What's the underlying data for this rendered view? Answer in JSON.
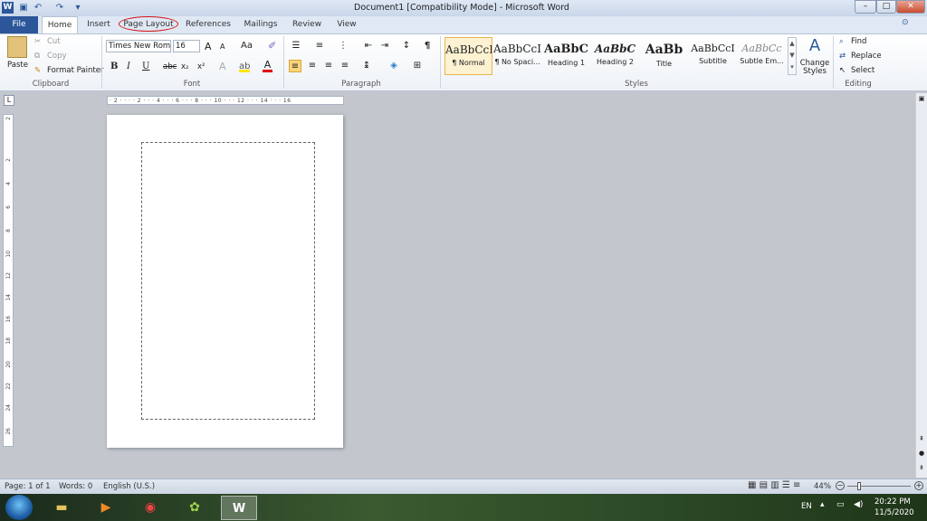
{
  "window": {
    "title": "Document1 [Compatibility Mode]  -  Microsoft Word",
    "logo": "W",
    "qat_icons": [
      "save-icon",
      "undo-icon",
      "redo-icon",
      "customize-qat-icon"
    ],
    "controls": {
      "minimize": "–",
      "maximize": "□",
      "close": "✕"
    }
  },
  "tabs": {
    "file": "File",
    "items": [
      "Home",
      "Insert",
      "Page Layout",
      "References",
      "Mailings",
      "Review",
      "View"
    ],
    "active": "Home",
    "highlighted": "Page Layout"
  },
  "clipboard": {
    "paste": "Paste",
    "cut": "Cut",
    "copy": "Copy",
    "format_painter": "Format Painter",
    "label": "Clipboard"
  },
  "font": {
    "family": "Times New Rom",
    "size": "16",
    "grow": "A",
    "shrink": "A",
    "case": "Aa",
    "clear": "",
    "bold": "B",
    "italic": "I",
    "underline": "U",
    "strike": "abc",
    "subscript": "x₂",
    "superscript": "x²",
    "label": "Font"
  },
  "paragraph": {
    "label": "Paragraph",
    "show_marks": "¶"
  },
  "styles": {
    "label": "Styles",
    "items": [
      {
        "sample": "AaBbCcI",
        "name": "¶ Normal"
      },
      {
        "sample": "AaBbCcI",
        "name": "¶ No Spaci..."
      },
      {
        "sample": "AaBbC",
        "name": "Heading 1"
      },
      {
        "sample": "AaBbC",
        "name": "Heading 2"
      },
      {
        "sample": "AaBb",
        "name": "Title"
      },
      {
        "sample": "AaBbCcI",
        "name": "Subtitle"
      },
      {
        "sample": "AaBbCc",
        "name": "Subtle Em..."
      }
    ],
    "change_styles": "Change Styles"
  },
  "editing": {
    "find": "Find",
    "replace": "Replace",
    "select": "Select",
    "label": "Editing"
  },
  "ruler": {
    "h_ticks": "· 2 · · · · 2 · · · 4 · · · 6 · · · 8 · · · 10 · · · 12 · · · 14 · · · 16"
  },
  "v_ruler_ticks": [
    "2",
    "2",
    "4",
    "6",
    "8",
    "10",
    "12",
    "14",
    "16",
    "18",
    "20",
    "22",
    "24",
    "26"
  ],
  "status": {
    "page": "Page: 1 of 1",
    "words": "Words: 0",
    "language": "English (U.S.)",
    "zoom": "44%"
  },
  "taskbar": {
    "lang": "EN",
    "time": "20:22 PM",
    "date": "11/5/2020"
  }
}
